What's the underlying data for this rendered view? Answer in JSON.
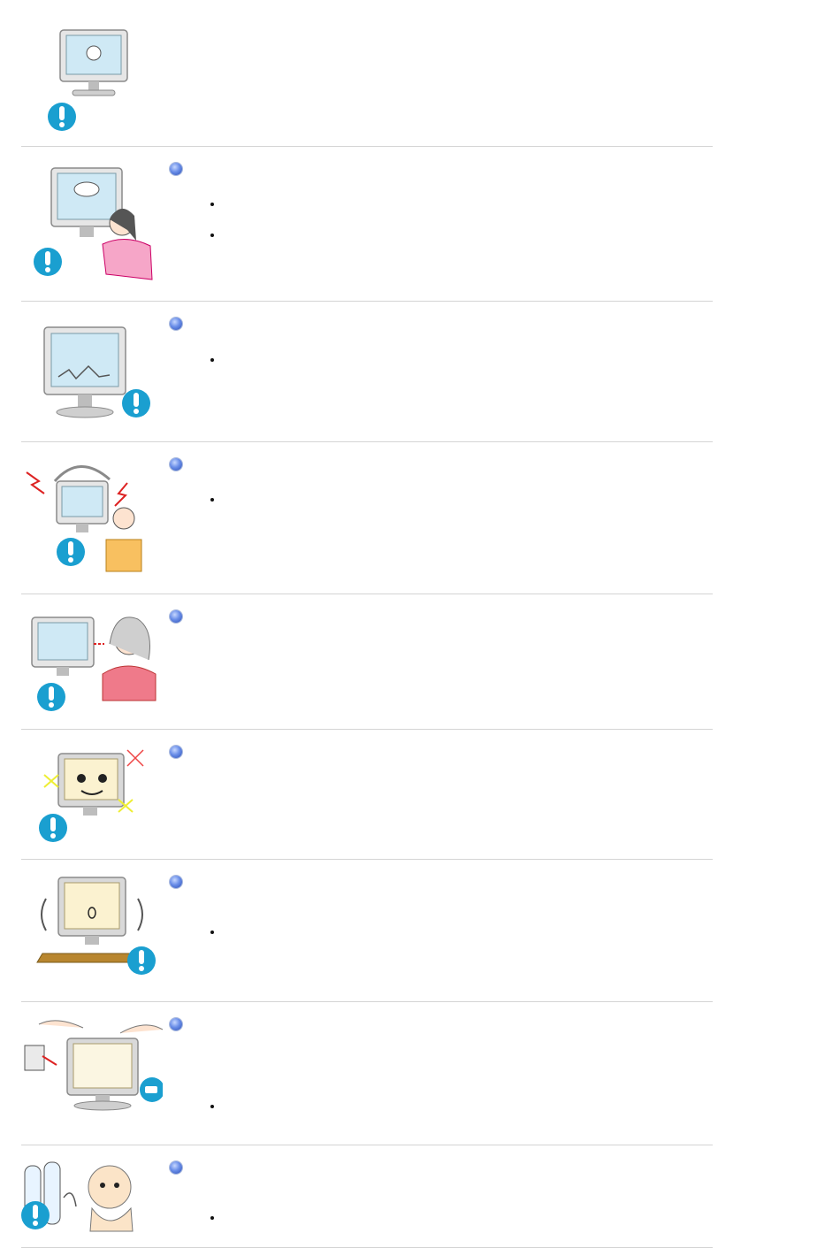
{
  "document": {
    "sections": [
      {
        "illustration": "monitor-with-warning-icon",
        "bullets": 0
      },
      {
        "illustration": "woman-cleaning-monitor-warning-icon",
        "bullets": 2
      },
      {
        "illustration": "monitor-display-warning-icon",
        "bullets": 1
      },
      {
        "illustration": "monitor-with-headphones-noise-warning-icon",
        "bullets": 1
      },
      {
        "illustration": "monitor-viewing-distance-woman-warning-icon",
        "bullets": 0
      },
      {
        "illustration": "monitor-smiling-face-warning-icon",
        "bullets": 0
      },
      {
        "illustration": "monitor-shaking-on-table-warning-icon",
        "bullets": 1
      },
      {
        "illustration": "unplug-monitor-hands-icon",
        "bullets": 1
      },
      {
        "illustration": "batteries-and-baby-warning-icon",
        "bullets": 1
      }
    ]
  },
  "colors": {
    "warning_blue": "#1a9fd0",
    "divider": "#d4d4d4",
    "bullet_dot": "#4b6fd6"
  }
}
